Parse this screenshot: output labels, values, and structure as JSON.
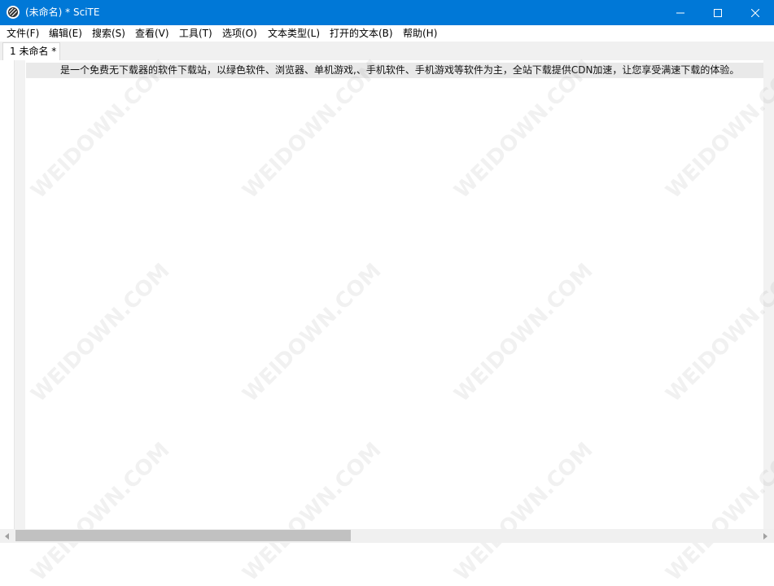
{
  "window": {
    "title": "(未命名) * SciTE",
    "app_icon": "scite-icon",
    "controls": [
      "minimize-icon",
      "maximize-icon",
      "close-icon"
    ]
  },
  "menu": [
    "文件(F)",
    "编辑(E)",
    "搜索(S)",
    "查看(V)",
    "工具(T)",
    "选项(O)",
    "文本类型(L)",
    "打开的文本(B)",
    "帮助(H)"
  ],
  "tabs": [
    {
      "label": "1 未命名 *"
    }
  ],
  "editor": {
    "lines": [
      "是一个免费无下载器的软件下载站，以绿色软件、浏览器、单机游戏,、手机软件、手机游戏等软件为主，全站下载提供CDN加速，让您享受满速下载的体验。"
    ],
    "highlight_color": "#e9e9e9"
  },
  "watermark": "WEIDOWN.COM",
  "colors": {
    "titlebar": "#0078d7",
    "background": "#ffffff",
    "margin": "#f2f2f2"
  }
}
